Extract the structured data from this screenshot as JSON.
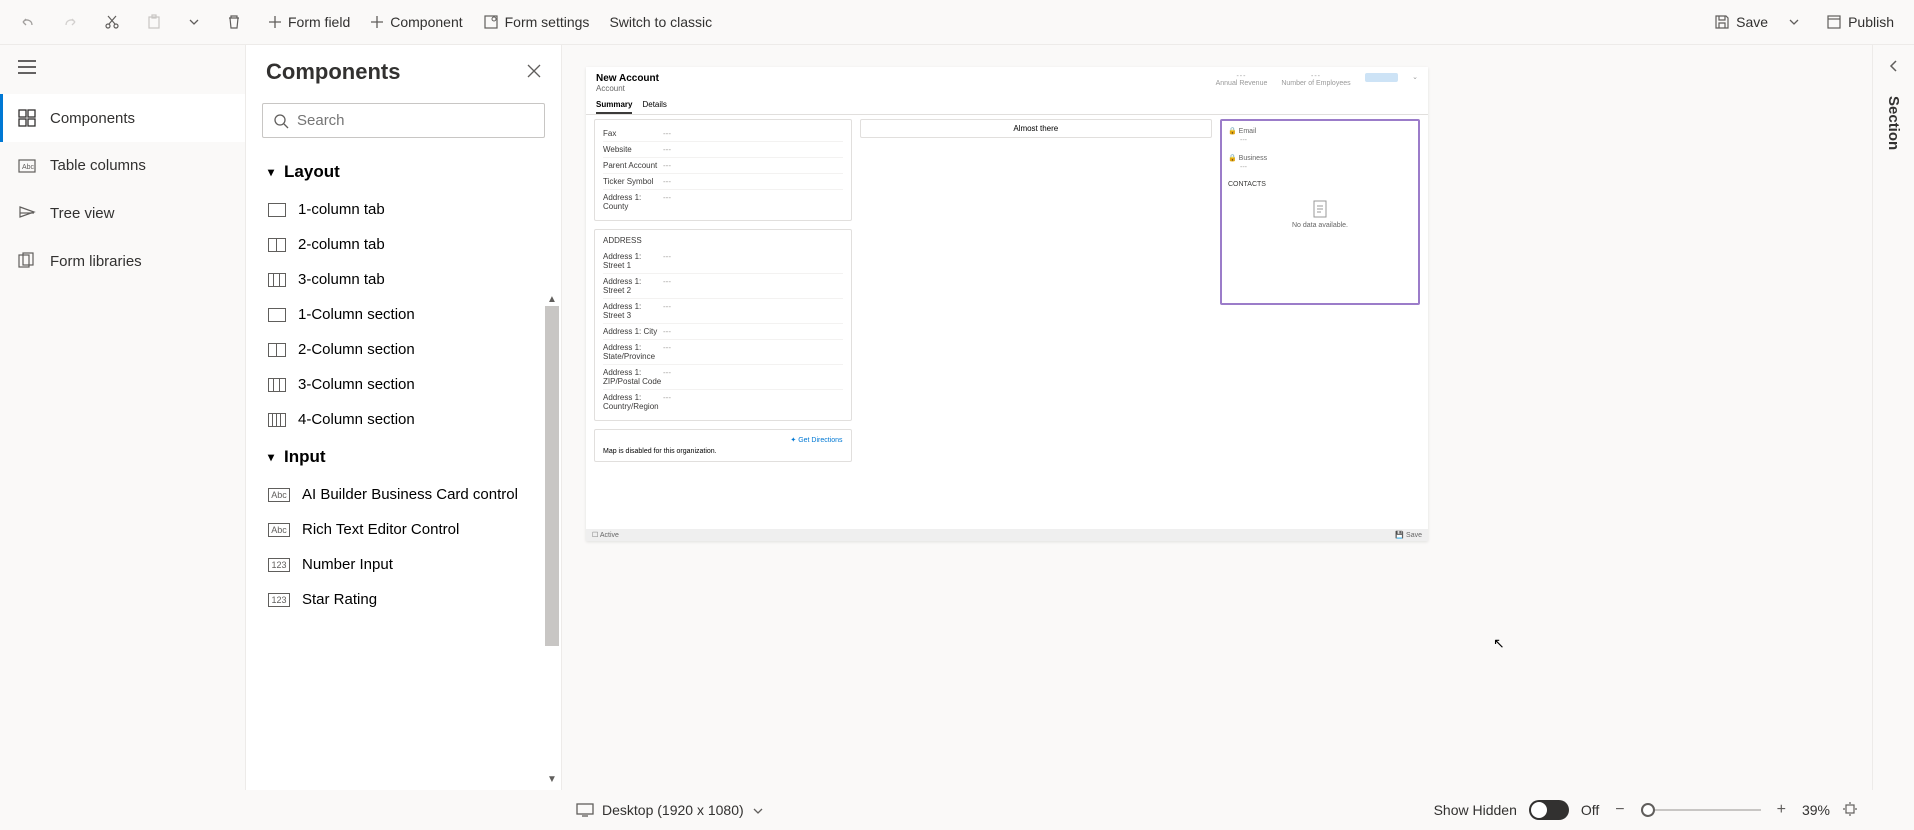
{
  "toolbar": {
    "form_field": "Form field",
    "component": "Component",
    "form_settings": "Form settings",
    "switch_classic": "Switch to classic",
    "save": "Save",
    "publish": "Publish"
  },
  "left_nav": {
    "items": [
      {
        "label": "Components"
      },
      {
        "label": "Table columns"
      },
      {
        "label": "Tree view"
      },
      {
        "label": "Form libraries"
      }
    ]
  },
  "components_panel": {
    "title": "Components",
    "search_placeholder": "Search",
    "groups": {
      "layout": {
        "title": "Layout",
        "items": [
          "1-column tab",
          "2-column tab",
          "3-column tab",
          "1-Column section",
          "2-Column section",
          "3-Column section",
          "4-Column section"
        ]
      },
      "input": {
        "title": "Input",
        "items": [
          "AI Builder Business Card control",
          "Rich Text Editor Control",
          "Number Input",
          "Star Rating"
        ]
      }
    }
  },
  "form_preview": {
    "title": "New Account",
    "subtitle": "Account",
    "tabs": [
      "Summary",
      "Details"
    ],
    "header_meta": [
      "Annual Revenue",
      "Number of Employees"
    ],
    "top_fields": [
      {
        "label": "Fax",
        "value": "---"
      },
      {
        "label": "Website",
        "value": "---"
      },
      {
        "label": "Parent Account",
        "value": "---"
      },
      {
        "label": "Ticker Symbol",
        "value": "---"
      },
      {
        "label": "Address 1: County",
        "value": "---"
      }
    ],
    "address_title": "ADDRESS",
    "address_fields": [
      {
        "label": "Address 1: Street 1",
        "value": "---"
      },
      {
        "label": "Address 1: Street 2",
        "value": "---"
      },
      {
        "label": "Address 1: Street 3",
        "value": "---"
      },
      {
        "label": "Address 1: City",
        "value": "---"
      },
      {
        "label": "Address 1: State/Province",
        "value": "---"
      },
      {
        "label": "Address 1: ZIP/Postal Code",
        "value": "---"
      },
      {
        "label": "Address 1: Country/Region",
        "value": "---"
      }
    ],
    "get_directions": "Get Directions",
    "map_disabled": "Map is disabled for this organization.",
    "middle_almost": "Almost there",
    "side_fields": [
      {
        "label": "Email",
        "value": "---"
      },
      {
        "label": "Business",
        "value": "---"
      }
    ],
    "contacts_header": "CONTACTS",
    "no_data": "No data available.",
    "footer_status": "Active",
    "footer_save": "Save"
  },
  "right_pane": {
    "label": "Section"
  },
  "bottom_bar": {
    "viewport": "Desktop (1920 x 1080)",
    "show_hidden": "Show Hidden",
    "toggle_state": "Off",
    "zoom": "39%"
  }
}
